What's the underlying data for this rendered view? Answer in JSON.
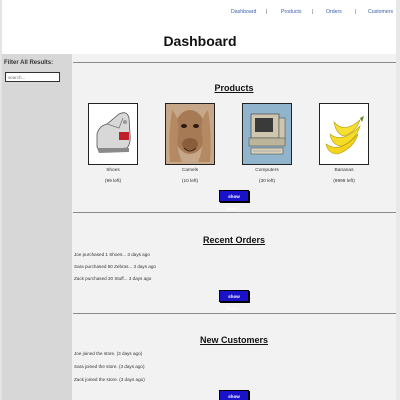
{
  "nav": {
    "items": [
      "Dashboard",
      "Products",
      "Orders",
      "Customers"
    ],
    "separator": "|"
  },
  "page_title": "Dashboard",
  "sidebar": {
    "title": "Filter All Results:",
    "search_placeholder": "search..."
  },
  "products": {
    "title": "Products",
    "items": [
      {
        "name": "Shoes",
        "stock": "(99 left)",
        "icon": "shoe-image"
      },
      {
        "name": "Camels",
        "stock": "(10 left)",
        "icon": "camel-image"
      },
      {
        "name": "Computers",
        "stock": "(30 left)",
        "icon": "computer-image"
      },
      {
        "name": "Bananas",
        "stock": "(9999 left)",
        "icon": "bananas-image"
      }
    ],
    "button": "show more..."
  },
  "orders": {
    "title": "Recent Orders",
    "rows": [
      "Joe purchased 1 Shoes... 3 days ago",
      "Sara purchased 50 Zebras... 3 days ago",
      "Zack purchased 20 Stuff... 3 days ago"
    ],
    "button": "show more..."
  },
  "customers": {
    "title": "New Customers",
    "rows": [
      "Joe joined the store. (3 days ago)",
      "Sara joined the store. (3 days ago)",
      "Zack joined the store. (3 days ago)"
    ],
    "button": "show more..."
  },
  "colors": {
    "nav_link": "#3a5fa8",
    "button_bg": "#1a12c9",
    "sidebar_bg": "#d7d7d7",
    "main_bg": "#f2f2f2"
  }
}
